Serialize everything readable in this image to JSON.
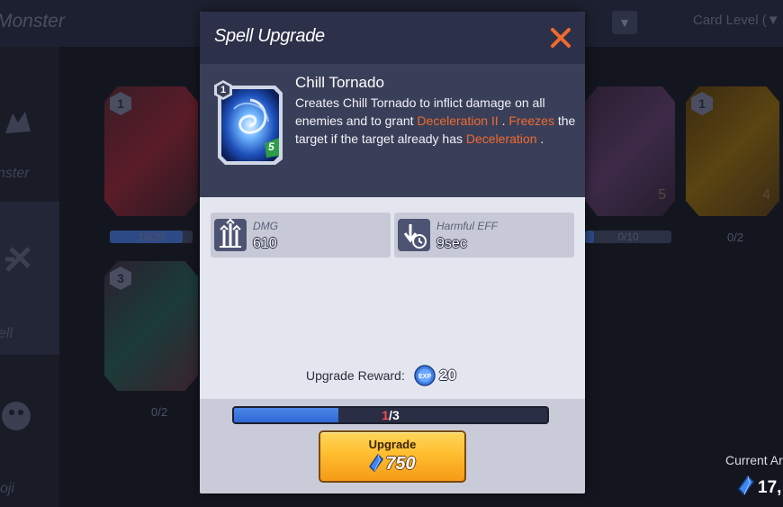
{
  "background": {
    "screen_title": "Monster",
    "sort_label": "Card Level (▼",
    "sidebar": [
      {
        "label": "nster",
        "icon": "monster-icon"
      },
      {
        "label": "ell",
        "icon": "spell-icon"
      },
      {
        "label": "oji",
        "icon": "emoji-icon"
      }
    ],
    "cards": [
      {
        "level": "1",
        "progress": "18/20",
        "count": ""
      },
      {
        "level": "3",
        "progress": "",
        "count": "0/2"
      },
      {
        "level": "",
        "progress": "0/10",
        "count": ""
      },
      {
        "level": "1",
        "progress": "",
        "count": "0/2"
      }
    ],
    "card_costs": [
      "5",
      "4"
    ],
    "currency_label": "Current Ar",
    "currency_value": "17,"
  },
  "modal": {
    "title": "Spell Upgrade",
    "close_icon": "close-icon",
    "spell": {
      "name": "Chill Tornado",
      "level": "1",
      "cost": "5",
      "desc_parts": [
        {
          "text": "Creates Chill Tornado to inflict damage on all enemies and to grant ",
          "hl": false
        },
        {
          "text": "Deceleration II",
          "hl": true
        },
        {
          "text": " . ",
          "hl": false
        },
        {
          "text": "Freezes",
          "hl": true
        },
        {
          "text": " the target if the target already has ",
          "hl": false
        },
        {
          "text": "Deceleration",
          "hl": true
        },
        {
          "text": " .",
          "hl": false
        }
      ]
    },
    "stats": [
      {
        "label": "DMG",
        "value": "610",
        "icon": "damage-icon"
      },
      {
        "label": "Harmful EFF",
        "value": "9sec",
        "icon": "harmful-effect-icon"
      }
    ],
    "reward": {
      "label": "Upgrade Reward:",
      "icon": "exp-icon",
      "value": "20"
    },
    "progress": {
      "current": "1",
      "total": "3",
      "fraction": 0.3333
    },
    "upgrade_button": {
      "label": "Upgrade",
      "cost": "750",
      "icon": "gem-icon"
    }
  },
  "colors": {
    "highlight": "#f06a2e",
    "header": "#2c3049",
    "button": "#ffbd2f",
    "progress": "#3a78e0"
  }
}
